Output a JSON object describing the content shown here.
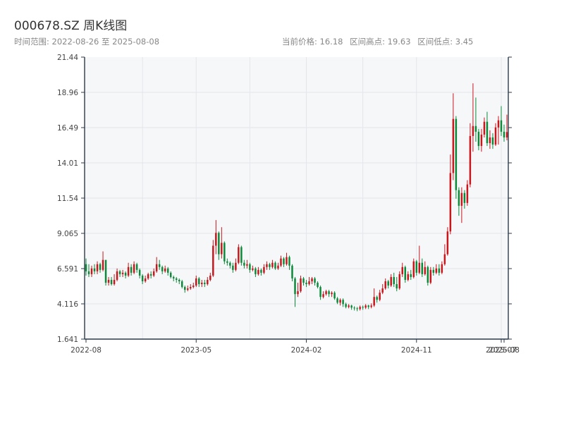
{
  "header": {
    "title": "000678.SZ 周K线图",
    "range_label": "时间范围: 2022-08-26 至 2025-08-08",
    "current_price": "当前价格: 16.18",
    "range_high": "区间高点: 19.63",
    "range_low": "区间低点: 3.45"
  },
  "colors": {
    "up": "#c8161d",
    "down": "#0b8a3a",
    "plot_bg": "#f6f7f9",
    "grid": "#e3e6ea",
    "axis": "#2d3a4a"
  },
  "chart_data": {
    "type": "candlestick",
    "title": "000678.SZ 周K线图",
    "ylim": [
      1.641,
      21.44
    ],
    "y_ticks": [
      "1.641",
      "4.116",
      "6.591",
      "9.065",
      "11.54",
      "14.01",
      "16.49",
      "18.96",
      "21.44"
    ],
    "x_ticks": [
      "2022-08",
      "2023-05",
      "2024-02",
      "2024-11",
      "2025-07",
      "2025-08"
    ],
    "grid": true,
    "candles": [
      [
        6.9,
        6.4,
        7.3,
        6.1
      ],
      [
        6.4,
        6.2,
        6.9,
        6.0
      ],
      [
        6.2,
        6.6,
        6.8,
        6.0
      ],
      [
        6.6,
        6.4,
        6.9,
        6.2
      ],
      [
        6.4,
        6.9,
        7.1,
        6.2
      ],
      [
        6.9,
        6.5,
        7.0,
        6.3
      ],
      [
        6.5,
        7.2,
        7.8,
        6.4
      ],
      [
        7.2,
        5.6,
        7.2,
        5.4
      ],
      [
        5.6,
        5.8,
        6.0,
        5.4
      ],
      [
        5.8,
        5.5,
        6.0,
        5.4
      ],
      [
        5.5,
        5.8,
        6.2,
        5.4
      ],
      [
        5.8,
        6.4,
        6.6,
        5.7
      ],
      [
        6.4,
        6.2,
        6.5,
        6.0
      ],
      [
        6.2,
        6.3,
        6.5,
        6.0
      ],
      [
        6.3,
        6.1,
        6.4,
        5.9
      ],
      [
        6.1,
        6.7,
        7.0,
        6.0
      ],
      [
        6.7,
        6.3,
        6.9,
        6.1
      ],
      [
        6.3,
        6.9,
        7.1,
        6.2
      ],
      [
        6.9,
        6.5,
        7.0,
        6.3
      ],
      [
        6.5,
        6.1,
        6.6,
        5.9
      ],
      [
        6.1,
        5.7,
        6.2,
        5.5
      ],
      [
        5.7,
        5.9,
        6.1,
        5.6
      ],
      [
        5.9,
        6.2,
        6.3,
        5.8
      ],
      [
        6.2,
        6.1,
        6.4,
        5.9
      ],
      [
        6.1,
        6.4,
        6.6,
        6.0
      ],
      [
        6.4,
        6.9,
        7.4,
        6.3
      ],
      [
        6.9,
        6.7,
        7.2,
        6.5
      ],
      [
        6.7,
        6.4,
        6.8,
        6.2
      ],
      [
        6.4,
        6.6,
        6.8,
        6.3
      ],
      [
        6.6,
        6.3,
        6.7,
        6.1
      ],
      [
        6.3,
        6.0,
        6.4,
        5.9
      ],
      [
        6.0,
        5.9,
        6.1,
        5.7
      ],
      [
        5.9,
        5.8,
        6.0,
        5.6
      ],
      [
        5.8,
        5.7,
        5.9,
        5.5
      ],
      [
        5.7,
        5.3,
        5.8,
        5.2
      ],
      [
        5.3,
        5.1,
        5.4,
        4.9
      ],
      [
        5.1,
        5.2,
        5.4,
        5.0
      ],
      [
        5.2,
        5.3,
        5.5,
        5.1
      ],
      [
        5.3,
        5.4,
        5.6,
        5.2
      ],
      [
        5.4,
        5.9,
        6.1,
        5.3
      ],
      [
        5.9,
        5.5,
        6.0,
        5.3
      ],
      [
        5.5,
        5.6,
        5.8,
        5.3
      ],
      [
        5.6,
        5.5,
        5.8,
        5.3
      ],
      [
        5.5,
        5.8,
        6.0,
        5.4
      ],
      [
        5.8,
        6.1,
        6.3,
        5.7
      ],
      [
        6.1,
        8.2,
        8.6,
        6.0
      ],
      [
        8.2,
        9.1,
        10.0,
        7.6
      ],
      [
        9.1,
        7.6,
        9.2,
        7.2
      ],
      [
        7.6,
        8.4,
        9.5,
        7.3
      ],
      [
        8.4,
        7.1,
        8.5,
        6.9
      ],
      [
        7.1,
        7.0,
        7.3,
        6.8
      ],
      [
        7.0,
        6.8,
        7.1,
        6.6
      ],
      [
        6.8,
        6.5,
        7.0,
        6.3
      ],
      [
        6.5,
        7.0,
        7.3,
        6.4
      ],
      [
        7.0,
        8.1,
        8.3,
        6.9
      ],
      [
        8.1,
        7.0,
        8.2,
        6.8
      ],
      [
        7.0,
        6.8,
        7.2,
        6.6
      ],
      [
        6.8,
        6.9,
        7.2,
        6.6
      ],
      [
        6.9,
        6.5,
        7.0,
        6.3
      ],
      [
        6.5,
        6.6,
        6.8,
        6.4
      ],
      [
        6.6,
        6.2,
        6.7,
        6.0
      ],
      [
        6.2,
        6.5,
        6.7,
        6.1
      ],
      [
        6.5,
        6.3,
        6.6,
        6.1
      ],
      [
        6.3,
        6.7,
        6.9,
        6.2
      ],
      [
        6.7,
        6.9,
        7.1,
        6.5
      ],
      [
        6.9,
        6.7,
        7.0,
        6.5
      ],
      [
        6.7,
        7.0,
        7.2,
        6.6
      ],
      [
        7.0,
        6.6,
        7.1,
        6.5
      ],
      [
        6.6,
        6.8,
        7.0,
        6.5
      ],
      [
        6.8,
        7.3,
        7.5,
        6.7
      ],
      [
        7.3,
        6.9,
        7.4,
        6.7
      ],
      [
        6.9,
        7.4,
        7.7,
        6.8
      ],
      [
        7.4,
        6.8,
        7.5,
        6.5
      ],
      [
        6.8,
        5.9,
        6.9,
        5.7
      ],
      [
        5.9,
        4.8,
        6.0,
        3.9
      ],
      [
        4.8,
        5.0,
        5.6,
        4.6
      ],
      [
        5.0,
        5.9,
        6.1,
        4.9
      ],
      [
        5.9,
        5.6,
        6.0,
        5.4
      ],
      [
        5.6,
        5.5,
        5.8,
        5.3
      ],
      [
        5.5,
        5.7,
        6.0,
        5.4
      ],
      [
        5.7,
        5.9,
        6.0,
        5.5
      ],
      [
        5.9,
        5.6,
        6.0,
        5.4
      ],
      [
        5.6,
        5.3,
        5.7,
        5.2
      ],
      [
        5.3,
        4.6,
        5.4,
        4.4
      ],
      [
        4.6,
        4.8,
        5.0,
        4.5
      ],
      [
        4.8,
        5.0,
        5.1,
        4.7
      ],
      [
        5.0,
        4.8,
        5.1,
        4.6
      ],
      [
        4.8,
        4.9,
        5.0,
        4.6
      ],
      [
        4.9,
        4.5,
        5.0,
        4.4
      ],
      [
        4.5,
        4.2,
        4.6,
        4.1
      ],
      [
        4.2,
        4.4,
        4.5,
        4.0
      ],
      [
        4.4,
        4.1,
        4.5,
        3.9
      ],
      [
        4.1,
        3.9,
        4.2,
        3.8
      ],
      [
        3.9,
        4.0,
        4.1,
        3.8
      ],
      [
        4.0,
        3.85,
        4.05,
        3.7
      ],
      [
        3.85,
        3.8,
        3.95,
        3.65
      ],
      [
        3.8,
        3.75,
        3.9,
        3.6
      ],
      [
        3.75,
        3.9,
        4.0,
        3.65
      ],
      [
        3.9,
        3.85,
        4.0,
        3.7
      ],
      [
        3.85,
        4.0,
        4.1,
        3.75
      ],
      [
        4.0,
        3.9,
        4.05,
        3.75
      ],
      [
        3.9,
        4.0,
        4.15,
        3.8
      ],
      [
        4.0,
        4.6,
        5.2,
        3.9
      ],
      [
        4.6,
        4.4,
        4.7,
        4.2
      ],
      [
        4.4,
        4.9,
        5.1,
        4.3
      ],
      [
        4.9,
        5.2,
        5.5,
        4.8
      ],
      [
        5.2,
        5.7,
        5.9,
        5.1
      ],
      [
        5.7,
        5.4,
        5.8,
        5.2
      ],
      [
        5.4,
        6.0,
        6.2,
        5.3
      ],
      [
        6.0,
        5.5,
        6.3,
        5.3
      ],
      [
        5.5,
        5.2,
        6.0,
        5.0
      ],
      [
        5.2,
        6.2,
        6.4,
        5.1
      ],
      [
        6.2,
        6.7,
        7.0,
        6.0
      ],
      [
        6.7,
        5.8,
        6.8,
        5.6
      ],
      [
        5.8,
        6.2,
        6.4,
        5.7
      ],
      [
        6.2,
        6.0,
        6.5,
        5.8
      ],
      [
        6.0,
        7.1,
        7.3,
        5.9
      ],
      [
        7.1,
        6.3,
        7.2,
        6.1
      ],
      [
        6.3,
        7.0,
        8.2,
        6.2
      ],
      [
        7.0,
        6.2,
        7.3,
        6.0
      ],
      [
        6.2,
        6.7,
        7.1,
        6.1
      ],
      [
        6.7,
        5.6,
        6.8,
        5.4
      ],
      [
        5.6,
        6.5,
        6.7,
        5.5
      ],
      [
        6.5,
        6.3,
        6.7,
        6.1
      ],
      [
        6.3,
        6.6,
        6.9,
        6.2
      ],
      [
        6.6,
        6.3,
        6.9,
        6.1
      ],
      [
        6.3,
        6.9,
        7.1,
        6.2
      ],
      [
        6.9,
        7.6,
        8.3,
        6.8
      ],
      [
        7.6,
        9.2,
        9.5,
        7.5
      ],
      [
        9.2,
        13.3,
        14.6,
        9.0
      ],
      [
        13.3,
        17.1,
        18.9,
        12.8
      ],
      [
        17.1,
        12.1,
        17.3,
        11.5
      ],
      [
        12.1,
        11.0,
        12.3,
        10.3
      ],
      [
        11.0,
        11.9,
        12.3,
        9.8
      ],
      [
        11.9,
        11.2,
        12.1,
        10.8
      ],
      [
        11.2,
        12.5,
        12.8,
        11.0
      ],
      [
        12.5,
        15.9,
        16.8,
        12.3
      ],
      [
        15.9,
        16.6,
        19.6,
        14.8
      ],
      [
        16.6,
        16.2,
        18.6,
        15.5
      ],
      [
        16.2,
        15.2,
        16.4,
        14.9
      ],
      [
        15.2,
        16.0,
        16.4,
        14.8
      ],
      [
        16.0,
        16.9,
        17.2,
        15.8
      ],
      [
        16.9,
        15.4,
        17.6,
        15.2
      ],
      [
        15.4,
        15.8,
        16.3,
        15.0
      ],
      [
        15.8,
        15.3,
        16.1,
        15.0
      ],
      [
        15.3,
        16.5,
        16.8,
        15.2
      ],
      [
        16.5,
        17.0,
        17.3,
        15.3
      ],
      [
        17.0,
        16.2,
        18.0,
        15.9
      ],
      [
        16.2,
        15.8,
        16.7,
        15.5
      ],
      [
        15.8,
        16.18,
        17.4,
        15.6
      ]
    ]
  }
}
